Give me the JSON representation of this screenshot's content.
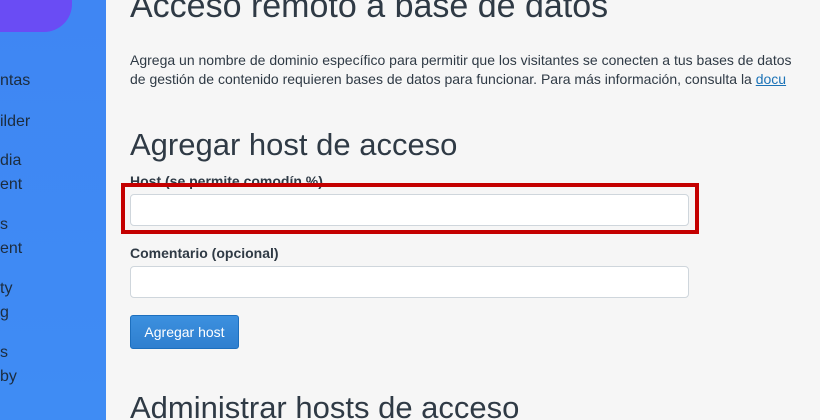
{
  "sidebar": {
    "items": [
      {
        "lines": [
          "ntas"
        ]
      },
      {
        "lines": [
          "ilder"
        ]
      },
      {
        "lines": [
          "dia",
          "ent"
        ]
      },
      {
        "lines": [
          "s",
          "ent"
        ]
      },
      {
        "lines": [
          "ty",
          "g"
        ]
      },
      {
        "lines": [
          "s",
          "by"
        ]
      }
    ]
  },
  "main": {
    "page_title": "Acceso remoto a base de datos",
    "intro": {
      "line1": "Agrega un nombre de dominio específico para permitir que los visitantes se conecten a tus bases de datos",
      "line2_prefix": "de gestión de contenido requieren bases de datos para funcionar. Para más información, consulta la ",
      "line2_link": "docu"
    },
    "add_host_section": {
      "title": "Agregar host de acceso",
      "host_label": "Host (se permite comodín %)",
      "host_value": "",
      "comment_label": "Comentario (opcional)",
      "comment_value": "",
      "submit_label": "Agregar host"
    },
    "manage_section_title": "Administrar hosts de acceso"
  },
  "colors": {
    "sidebar": "#3f8cf4",
    "logo": "#6a4cf4",
    "highlight": "#c40000",
    "primary_button": "#2f7fcf",
    "link": "#1c73b7"
  }
}
